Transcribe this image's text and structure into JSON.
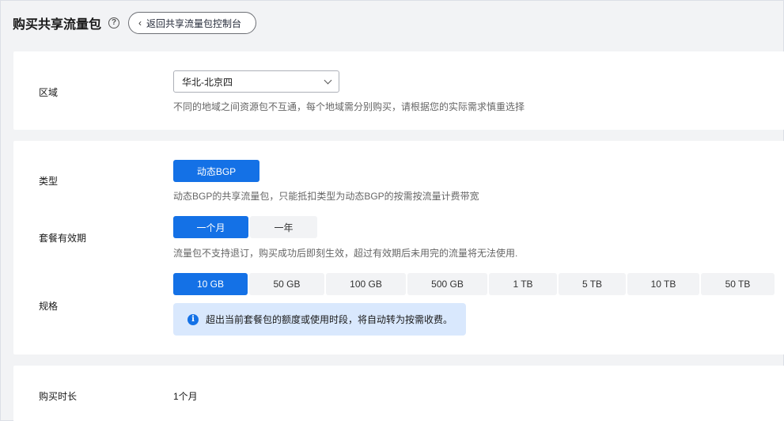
{
  "header": {
    "title": "购买共享流量包",
    "help_icon": "?",
    "back_label": "返回共享流量包控制台"
  },
  "region": {
    "label": "区域",
    "selected": "华北-北京四",
    "hint": "不同的地域之间资源包不互通，每个地域需分别购买，请根据您的实际需求慎重选择"
  },
  "type": {
    "label": "类型",
    "option": "动态BGP",
    "hint": "动态BGP的共享流量包，只能抵扣类型为动态BGP的按需按流量计费带宽"
  },
  "validity": {
    "label": "套餐有效期",
    "options": [
      "一个月",
      "一年"
    ],
    "selected_index": 0,
    "hint": "流量包不支持退订，购买成功后即刻生效，超过有效期后未用完的流量将无法使用."
  },
  "spec": {
    "label": "规格",
    "options": [
      "10 GB",
      "50 GB",
      "100 GB",
      "500 GB",
      "1 TB",
      "5 TB",
      "10 TB",
      "50 TB"
    ],
    "selected_index": 0,
    "notice": "超出当前套餐包的额度或使用时段，将自动转为按需收费。"
  },
  "duration": {
    "label": "购买时长",
    "value": "1个月"
  },
  "colors": {
    "primary": "#1471e6",
    "notice_bg": "#d9e8fd"
  }
}
